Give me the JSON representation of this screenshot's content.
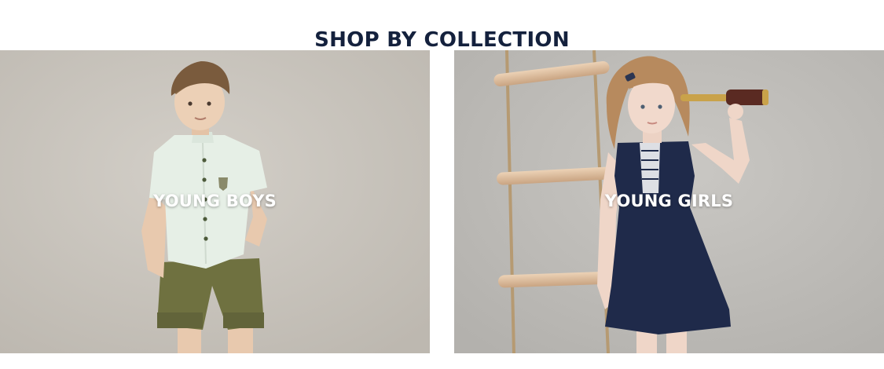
{
  "section": {
    "title": "SHOP BY COLLECTION"
  },
  "collections": [
    {
      "label": "YOUNG BOYS"
    },
    {
      "label": "YOUNG GIRLS"
    }
  ],
  "colors": {
    "heading": "#14213d",
    "photo_backdrop": "#c9c4bc",
    "label_text": "#ffffff"
  }
}
